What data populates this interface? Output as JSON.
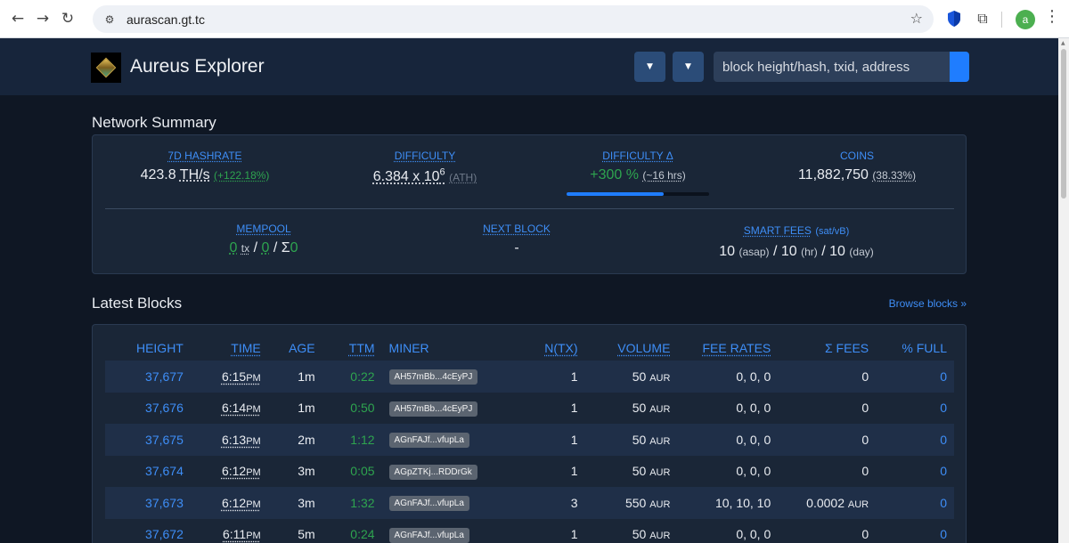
{
  "browser": {
    "url": "aurascan.gt.tc",
    "profile_initial": "a"
  },
  "header": {
    "title": "Aureus Explorer",
    "search_placeholder": "block height/hash, txid, address"
  },
  "network_summary": {
    "title": "Network Summary",
    "hashrate": {
      "label": "7D HASHRATE",
      "value": "423.8",
      "unit": "TH/s",
      "change": "(+122.18%)"
    },
    "difficulty": {
      "label": "DIFFICULTY",
      "value": "6.384 x 10",
      "exp": "6",
      "note": "(ATH)"
    },
    "difficulty_delta": {
      "label": "DIFFICULTY Δ",
      "value": "+300 %",
      "eta": "(~16 hrs)",
      "progress_fraction": 0.68
    },
    "coins": {
      "label": "COINS",
      "value": "11,882,750",
      "pct": "(38.33%)"
    },
    "mempool": {
      "label": "MEMPOOL",
      "tx_count": "0",
      "tx_unit": "tx",
      "sep1": "/",
      "vsize": "0",
      "sep2": "/",
      "sigma": "Σ",
      "total": "0"
    },
    "next_block": {
      "label": "NEXT BLOCK",
      "value": "-"
    },
    "smart_fees": {
      "label": "SMART FEES",
      "unit": "(sat/vB)",
      "asap": "10",
      "asap_label": "(asap)",
      "hr": "10",
      "hr_label": "(hr)",
      "day": "10",
      "day_label": "(day)",
      "sep": "/"
    }
  },
  "latest_blocks": {
    "title": "Latest Blocks",
    "browse_link": "Browse blocks »",
    "columns": [
      "HEIGHT",
      "TIME",
      "AGE",
      "TTM",
      "MINER",
      "N(TX)",
      "VOLUME",
      "FEE RATES",
      "Σ FEES",
      "% FULL"
    ],
    "rows": [
      {
        "height": "37,677",
        "time": "6:15",
        "ampm": "PM",
        "age": "1m",
        "ttm": "0:22",
        "miner": "AH57mBb...4cEyPJ",
        "ntx": "1",
        "volume": "50",
        "volume_unit": "AUR",
        "fee_rates": "0, 0, 0",
        "fees": "0",
        "fees_unit": "",
        "full": "0"
      },
      {
        "height": "37,676",
        "time": "6:14",
        "ampm": "PM",
        "age": "1m",
        "ttm": "0:50",
        "miner": "AH57mBb...4cEyPJ",
        "ntx": "1",
        "volume": "50",
        "volume_unit": "AUR",
        "fee_rates": "0, 0, 0",
        "fees": "0",
        "fees_unit": "",
        "full": "0"
      },
      {
        "height": "37,675",
        "time": "6:13",
        "ampm": "PM",
        "age": "2m",
        "ttm": "1:12",
        "miner": "AGnFAJf...vfupLa",
        "ntx": "1",
        "volume": "50",
        "volume_unit": "AUR",
        "fee_rates": "0, 0, 0",
        "fees": "0",
        "fees_unit": "",
        "full": "0"
      },
      {
        "height": "37,674",
        "time": "6:12",
        "ampm": "PM",
        "age": "3m",
        "ttm": "0:05",
        "miner": "AGpZTKj...RDDrGk",
        "ntx": "1",
        "volume": "50",
        "volume_unit": "AUR",
        "fee_rates": "0, 0, 0",
        "fees": "0",
        "fees_unit": "",
        "full": "0"
      },
      {
        "height": "37,673",
        "time": "6:12",
        "ampm": "PM",
        "age": "3m",
        "ttm": "1:32",
        "miner": "AGnFAJf...vfupLa",
        "ntx": "3",
        "volume": "550",
        "volume_unit": "AUR",
        "fee_rates": "10, 10, 10",
        "fees": "0.0002",
        "fees_unit": "AUR",
        "full": "0"
      },
      {
        "height": "37,672",
        "time": "6:11",
        "ampm": "PM",
        "age": "5m",
        "ttm": "0:24",
        "miner": "AGnFAJf...vfupLa",
        "ntx": "1",
        "volume": "50",
        "volume_unit": "AUR",
        "fee_rates": "0, 0, 0",
        "fees": "0",
        "fees_unit": "",
        "full": "0"
      }
    ]
  }
}
